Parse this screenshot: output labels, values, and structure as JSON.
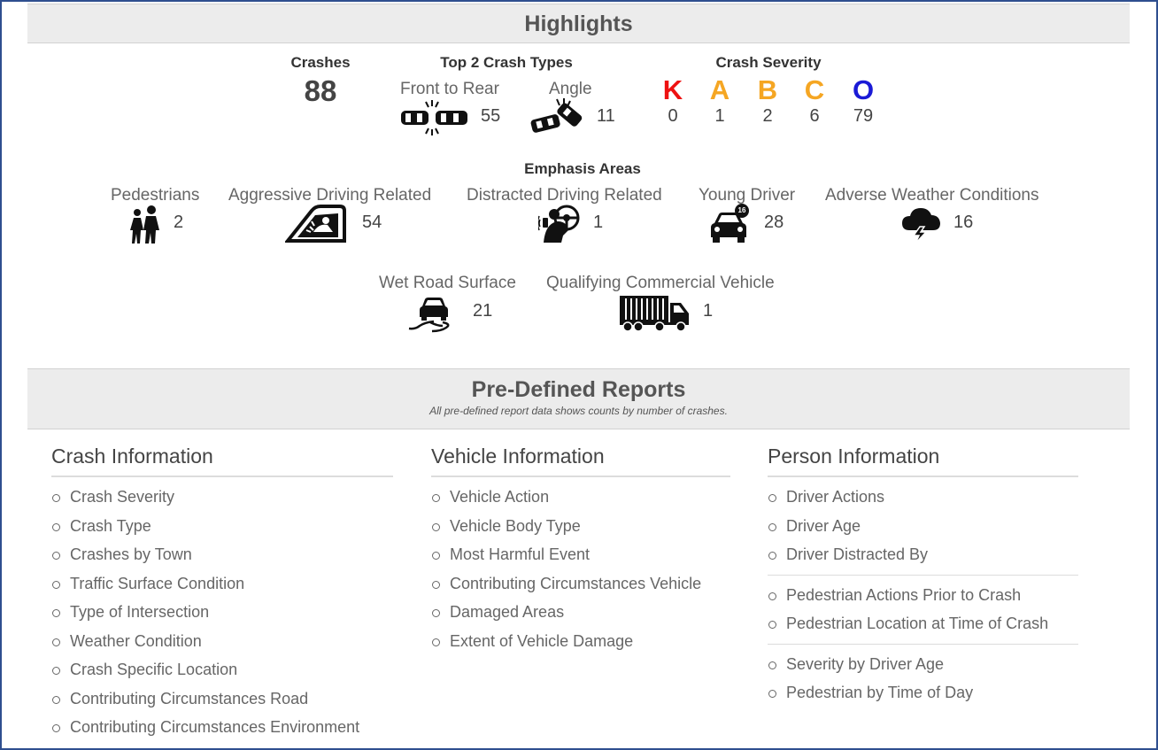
{
  "highlights": {
    "title": "Highlights",
    "crashes": {
      "label": "Crashes",
      "value": "88"
    },
    "top_types": {
      "label": "Top 2 Crash Types",
      "items": [
        {
          "name": "Front to Rear",
          "value": "55",
          "icon": "front-to-rear-icon"
        },
        {
          "name": "Angle",
          "value": "11",
          "icon": "angle-crash-icon"
        }
      ]
    },
    "severity": {
      "label": "Crash Severity",
      "levels": [
        {
          "letter": "K",
          "value": "0",
          "color": "#ee1111"
        },
        {
          "letter": "A",
          "value": "1",
          "color": "#f5a623"
        },
        {
          "letter": "B",
          "value": "2",
          "color": "#f5a623"
        },
        {
          "letter": "C",
          "value": "6",
          "color": "#f5a623"
        },
        {
          "letter": "O",
          "value": "79",
          "color": "#1a1ad6"
        }
      ]
    },
    "emphasis": {
      "label": "Emphasis Areas",
      "items": [
        {
          "name": "Pedestrians",
          "value": "2",
          "icon": "pedestrians-icon"
        },
        {
          "name": "Aggressive Driving Related",
          "value": "54",
          "icon": "aggressive-driving-icon"
        },
        {
          "name": "Distracted Driving Related",
          "value": "1",
          "icon": "distracted-driver-icon"
        },
        {
          "name": "Young Driver",
          "value": "28",
          "icon": "young-driver-icon",
          "badge": "16"
        },
        {
          "name": "Adverse Weather Conditions",
          "value": "16",
          "icon": "storm-cloud-icon"
        },
        {
          "name": "Wet Road Surface",
          "value": "21",
          "icon": "wet-road-icon"
        },
        {
          "name": "Qualifying Commercial Vehicle",
          "value": "1",
          "icon": "truck-icon"
        }
      ]
    }
  },
  "reports": {
    "title": "Pre-Defined Reports",
    "subtitle": "All pre-defined report data shows counts by number of crashes.",
    "crash": {
      "title": "Crash Information",
      "items": [
        "Crash Severity",
        "Crash Type",
        "Crashes by Town",
        "Traffic Surface Condition",
        "Type of Intersection",
        "Weather Condition",
        "Crash Specific Location",
        "Contributing Circumstances Road",
        "Contributing Circumstances Environment"
      ]
    },
    "vehicle": {
      "title": "Vehicle Information",
      "items": [
        "Vehicle Action",
        "Vehicle Body Type",
        "Most Harmful Event",
        "Contributing Circumstances Vehicle",
        "Damaged Areas",
        "Extent of Vehicle Damage"
      ]
    },
    "person": {
      "title": "Person Information",
      "groups": [
        [
          "Driver Actions",
          "Driver Age",
          "Driver Distracted By"
        ],
        [
          "Pedestrian Actions Prior to Crash",
          "Pedestrian Location at Time of Crash"
        ],
        [
          "Severity by Driver Age",
          "Pedestrian by Time of Day"
        ]
      ]
    }
  }
}
